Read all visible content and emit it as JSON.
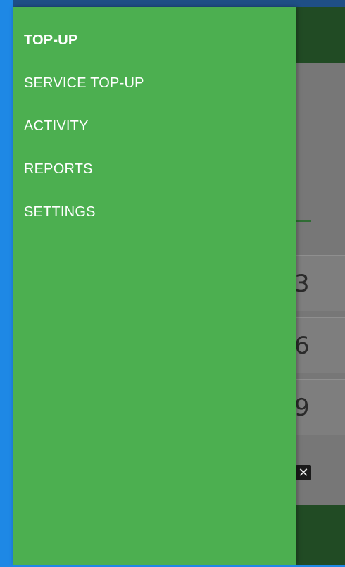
{
  "drawer": {
    "background_color": "#4caf50",
    "items": [
      {
        "label": "TOP-UP",
        "active": true
      },
      {
        "label": "SERVICE TOP-UP",
        "active": false
      },
      {
        "label": "ACTIVITY",
        "active": false
      },
      {
        "label": "REPORTS",
        "active": false
      },
      {
        "label": "SETTINGS",
        "active": false
      }
    ]
  },
  "background": {
    "rows": [
      {
        "digit": "3"
      },
      {
        "digit": "6"
      },
      {
        "digit": "9"
      }
    ],
    "clear_icon": "backspace-x-icon",
    "clear_glyph": "✕",
    "header_color": "#214b24"
  }
}
